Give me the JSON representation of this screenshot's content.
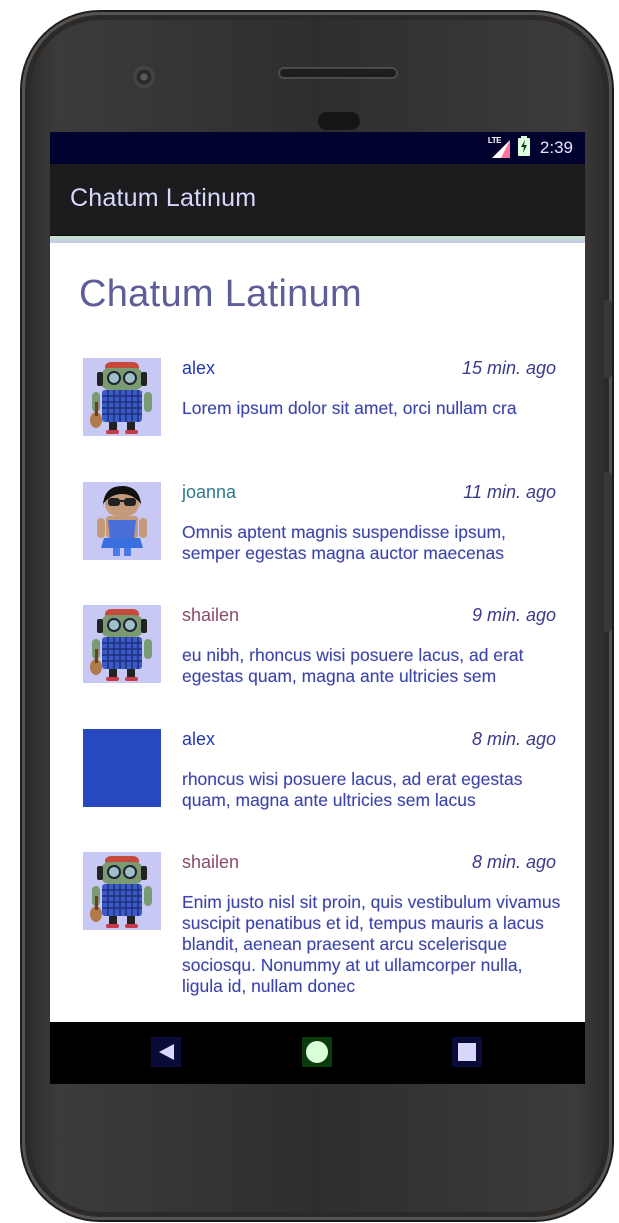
{
  "status_bar": {
    "network": "LTE",
    "time": "2:39"
  },
  "app_bar": {
    "title": "Chatum Latinum"
  },
  "heading": "Chatum Latinum",
  "messages": [
    {
      "name": "alex",
      "name_color": "#2238b0",
      "time_ago": "15 min. ago",
      "avatar": "android-robot-headphones",
      "text": "Lorem ipsum dolor sit amet, orci nullam cra"
    },
    {
      "name": "joanna",
      "name_color": "#2c7a8a",
      "time_ago": "11 min. ago",
      "avatar": "android-girl-sunglasses",
      "text": "Omnis aptent magnis suspendisse ipsum, semper egestas magna auctor maecenas"
    },
    {
      "name": "shailen",
      "name_color": "#8a4a6a",
      "time_ago": "9 min. ago",
      "avatar": "android-robot-headphones",
      "text": "eu nibh, rhoncus wisi posuere lacus, ad erat egestas quam, magna ante ultricies sem"
    },
    {
      "name": "alex",
      "name_color": "#2238b0",
      "time_ago": "8 min. ago",
      "avatar": "blue-square-placeholder",
      "text": "rhoncus wisi posuere lacus, ad erat egestas quam, magna ante ultricies sem lacus"
    },
    {
      "name": "shailen",
      "name_color": "#8a4a6a",
      "time_ago": "8 min. ago",
      "avatar": "android-robot-headphones",
      "text": "Enim justo nisl sit proin, quis vestibulum vivamus suscipit penatibus et id, tempus mauris a lacus blandit, aenean praesent arcu scelerisque sociosqu. Nonummy at ut ullamcorper nulla, ligula id, nullam donec"
    }
  ],
  "nav_bar": {
    "back": "back-triangle-icon",
    "home": "home-circle-icon",
    "recents": "recents-square-icon"
  }
}
